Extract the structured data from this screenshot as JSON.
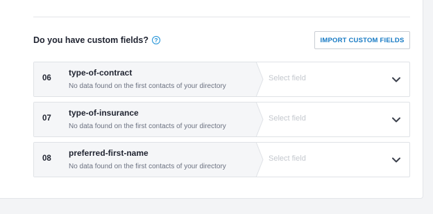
{
  "section": {
    "title": "Do you have custom fields?",
    "help_icon": "question-circle-icon",
    "import_button_label": "IMPORT CUSTOM FIELDS"
  },
  "rows": [
    {
      "number": "06",
      "name": "type-of-contract",
      "description": "No data found on the first contacts of your directory",
      "select_placeholder": "Select field"
    },
    {
      "number": "07",
      "name": "type-of-insurance",
      "description": "No data found on the first contacts of your directory",
      "select_placeholder": "Select field"
    },
    {
      "number": "08",
      "name": "preferred-first-name",
      "description": "No data found on the first contacts of your directory",
      "select_placeholder": "Select field"
    }
  ],
  "colors": {
    "accent": "#1479c4",
    "row_left_bg": "#f5f6f8",
    "border": "#dfe2e6"
  }
}
